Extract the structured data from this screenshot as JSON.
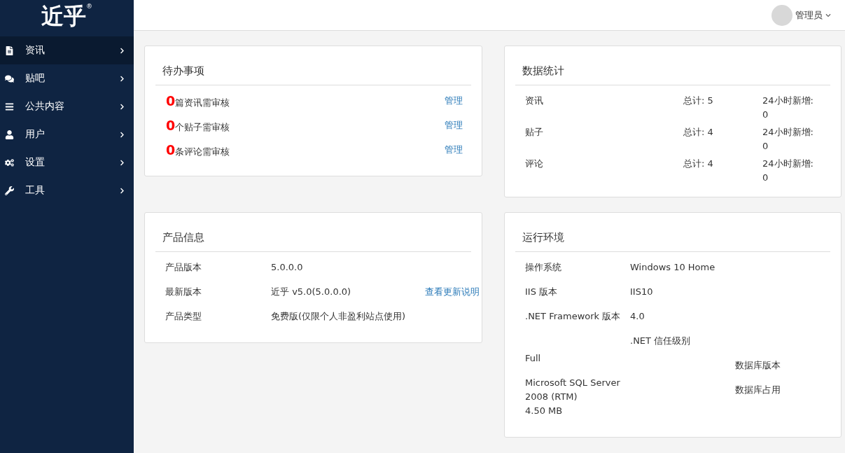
{
  "logo": {
    "text": "近乎",
    "mark": "®"
  },
  "sidebar": {
    "items": [
      {
        "label": "资讯",
        "selected": true
      },
      {
        "label": "贴吧",
        "selected": false
      },
      {
        "label": "公共内容",
        "selected": false
      },
      {
        "label": "用户",
        "selected": false
      },
      {
        "label": "设置",
        "selected": false
      },
      {
        "label": "工具",
        "selected": false
      }
    ]
  },
  "header": {
    "user": "管理员"
  },
  "todo": {
    "title": "待办事项",
    "items": [
      {
        "count": "0",
        "text": "篇资讯需审核",
        "link": "管理"
      },
      {
        "count": "0",
        "text": "个贴子需审核",
        "link": "管理"
      },
      {
        "count": "0",
        "text": "条评论需审核",
        "link": "管理"
      }
    ]
  },
  "stats": {
    "title": "数据统计",
    "rows": [
      {
        "name": "资讯",
        "total": "总计: 5",
        "recent": "24小时新增: 0"
      },
      {
        "name": "贴子",
        "total": "总计: 4",
        "recent": "24小时新增: 0"
      },
      {
        "name": "评论",
        "total": "总计: 4",
        "recent": "24小时新增: 0"
      }
    ]
  },
  "product": {
    "title": "产品信息",
    "rows": [
      {
        "label": "产品版本",
        "value": "5.0.0.0"
      },
      {
        "label": "最新版本",
        "value": "近乎 v5.0(5.0.0.0)",
        "link": "查看更新说明"
      },
      {
        "label": "产品类型",
        "value": "免费版(仅限个人非盈利站点使用)"
      }
    ]
  },
  "environment": {
    "title": "运行环境",
    "rows": [
      {
        "column_1": "操作系统",
        "column_2": "Windows 10 Home"
      },
      {
        "column_1": "IIS 版本",
        "column_2": "IIS10"
      },
      {
        "column_1": ".NET Framework 版本",
        "column_2": "4.0"
      },
      {
        "column_2": ".NET 信任级别"
      },
      {
        "column_1": "Full",
        "column_3": "数据库版本"
      },
      {
        "column_1": "Microsoft SQL Server 2008 (RTM)",
        "column_3": "数据库占用"
      },
      {
        "column_1": "4.50 MB"
      }
    ]
  }
}
